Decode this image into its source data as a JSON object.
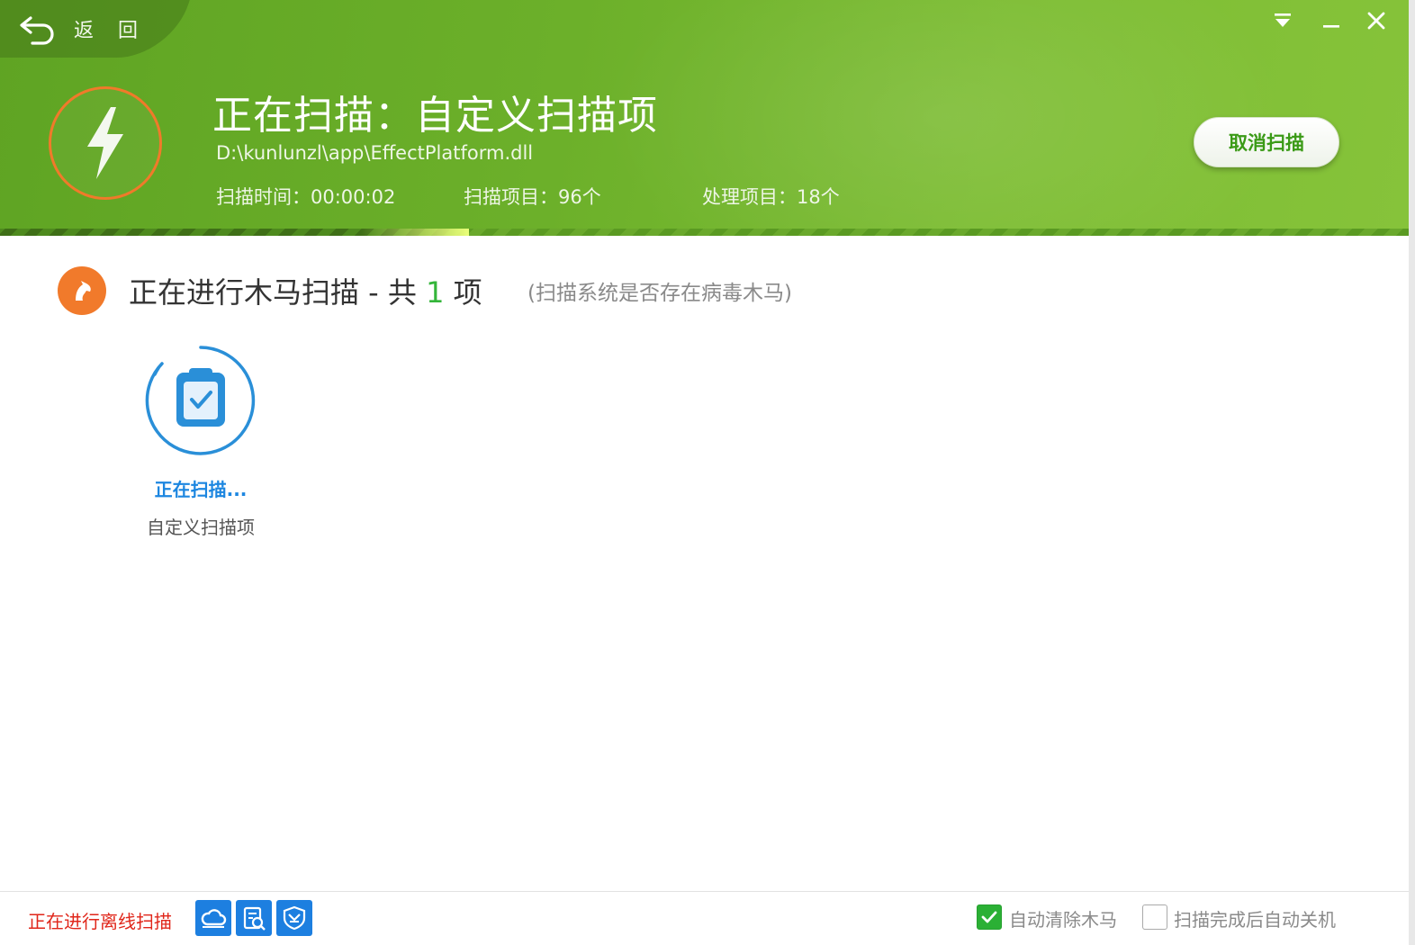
{
  "header": {
    "back_label": "返 回",
    "scan_title": "正在扫描：自定义扫描项",
    "current_path": "D:\\kunlunzl\\app\\EffectPlatform.dll",
    "stats": {
      "time": "扫描时间：00:00:02",
      "scanned": "扫描项目：96个",
      "processed": "处理项目：18个"
    },
    "cancel_label": "取消扫描",
    "progress": 0.333
  },
  "section": {
    "title_prefix": "正在进行木马扫描 - 共 ",
    "count": "1",
    "title_suffix": " 项",
    "subtitle": "(扫描系统是否存在病毒木马)"
  },
  "items": [
    {
      "status": "正在扫描...",
      "name": "自定义扫描项"
    }
  ],
  "footer": {
    "status": "正在进行离线扫描",
    "mode_icons": [
      "cloud-scan-icon",
      "engine-scan-icon",
      "shield-engine-icon"
    ],
    "auto_clean_label": "自动清除木马",
    "auto_clean_checked": true,
    "auto_shutdown_label": "扫描完成后自动关机",
    "auto_shutdown_checked": false
  },
  "colors": {
    "header_green": "#6cb02a",
    "accent_orange": "#f17a2b",
    "link_blue": "#1c86e0",
    "alert_red": "#e0261a",
    "check_green": "#2bb035"
  }
}
